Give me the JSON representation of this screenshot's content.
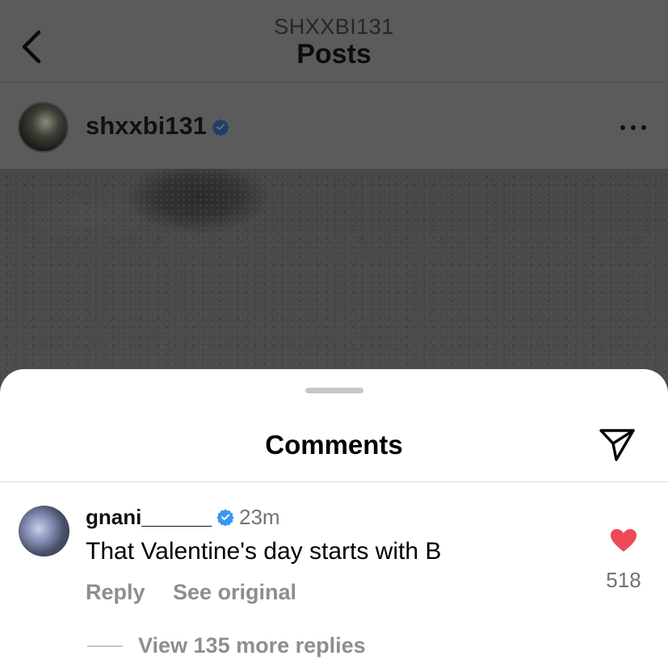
{
  "header": {
    "subtitle": "SHXXBI131",
    "title": "Posts"
  },
  "post": {
    "username": "shxxbi131",
    "verified": true
  },
  "comments_sheet": {
    "title": "Comments",
    "comments": [
      {
        "username": "gnani______",
        "verified": true,
        "time": "23m",
        "text": "That Valentine's day starts with B",
        "reply_label": "Reply",
        "see_original_label": "See original",
        "likes": "518",
        "liked": true,
        "view_replies_label": "View 135 more replies"
      }
    ]
  },
  "colors": {
    "verified_blue": "#3897f0",
    "like_red": "#ed4956",
    "overlay_gray": "#5b5b5b"
  },
  "icons": {
    "back": "chevron-left-icon",
    "verified": "verified-badge-icon",
    "more": "more-horizontal-icon",
    "share": "paper-plane-icon",
    "like": "heart-filled-icon"
  }
}
